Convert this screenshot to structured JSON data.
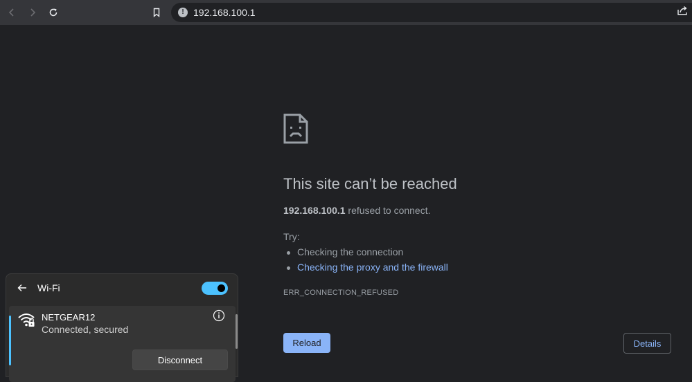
{
  "browser": {
    "url": "192.168.100.1"
  },
  "error_page": {
    "title": "This site can’t be reached",
    "host": "192.168.100.1",
    "detail_suffix": " refused to connect.",
    "try_label": "Try:",
    "suggestions": [
      "Checking the connection",
      "Checking the proxy and the firewall"
    ],
    "error_code": "ERR_CONNECTION_REFUSED",
    "reload_label": "Reload",
    "details_label": "Details"
  },
  "wifi_panel": {
    "title": "Wi-Fi",
    "toggle_on": true,
    "network": {
      "name": "NETGEAR12",
      "status": "Connected, secured",
      "disconnect_label": "Disconnect"
    }
  },
  "colors": {
    "page_bg": "#202124",
    "link": "#8ab4f8",
    "accent": "#4cc2ff"
  }
}
